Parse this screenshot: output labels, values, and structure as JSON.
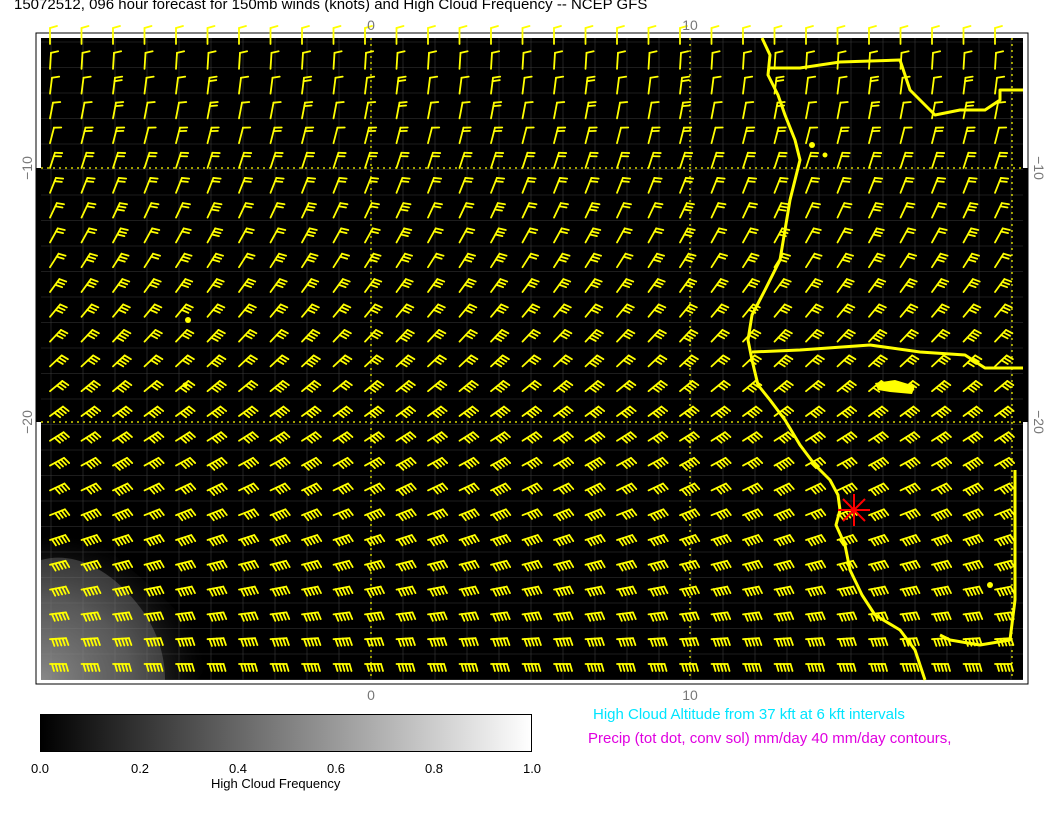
{
  "title": "15072512, 096 hour forecast for 150mb winds (knots) and High Cloud Frequency -- NCEP GFS",
  "axes": {
    "top_ticks": [
      "0",
      "10"
    ],
    "bottom_ticks": [
      "0",
      "10"
    ],
    "left_ticks": [
      "−10",
      "−20"
    ],
    "right_ticks": [
      "−10",
      "−20"
    ]
  },
  "colorbar": {
    "ticks": [
      "0.0",
      "0.2",
      "0.4",
      "0.6",
      "0.8",
      "1.0"
    ],
    "label": "High Cloud Frequency",
    "range": [
      0,
      1
    ],
    "colors": [
      "#000000",
      "#ffffff"
    ]
  },
  "legend": {
    "cloud_altitude": "High Cloud Altitude from 37 kft at 6 kft intervals",
    "precip": "Precip (tot dot, conv sol) mm/day 40 mm/day contours,"
  },
  "colors": {
    "map_background": "#000000",
    "wind_barbs": "#ffff00",
    "coastline": "#ffff00",
    "marker": "#ff0000",
    "legend_cyan": "#00e5ff",
    "legend_magenta": "#e000e0"
  },
  "map": {
    "lon_range": [
      -10,
      20
    ],
    "lat_range": [
      -30,
      -5
    ],
    "gridline_lons": [
      0,
      10
    ],
    "gridline_lats": [
      -10,
      -20
    ],
    "marker_symbol": "asterisk"
  }
}
